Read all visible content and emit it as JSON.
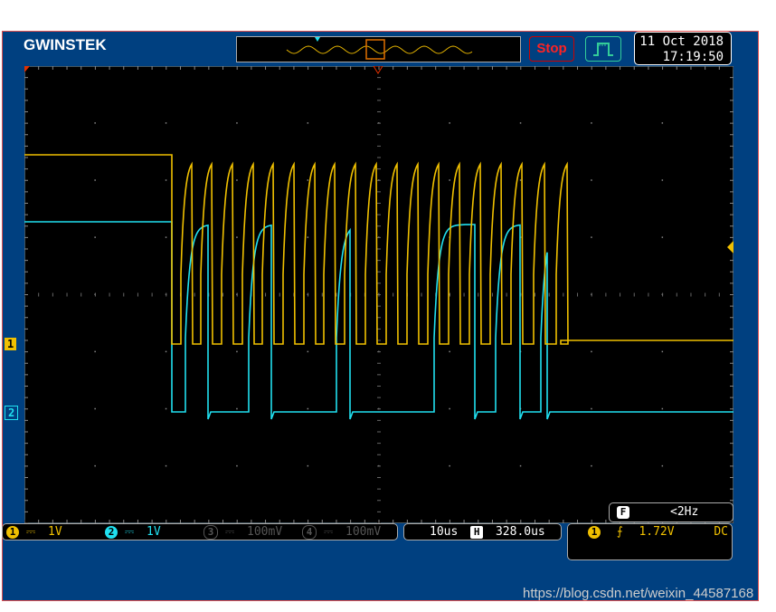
{
  "header": {
    "brand": "GWINSTEK",
    "run_state": "Stop",
    "date": "11 Oct 2018",
    "time": "17:19:50",
    "trigger_mode_icon": "pulse-icon"
  },
  "channels": [
    {
      "num": "1",
      "coupling": "DC",
      "scale": "1V",
      "color": "#f0c000",
      "active": true
    },
    {
      "num": "2",
      "coupling": "DC",
      "scale": "1V",
      "color": "#20e0f0",
      "active": true
    },
    {
      "num": "3",
      "coupling": "DC",
      "scale": "100mV",
      "color": "#555555",
      "active": false
    },
    {
      "num": "4",
      "coupling": "DC",
      "scale": "100mV",
      "color": "#555555",
      "active": false
    }
  ],
  "timebase": {
    "scale": "10us",
    "h_icon": "H",
    "position": "328.0us"
  },
  "trigger": {
    "source": "1",
    "slope": "rising",
    "level": "1.72V",
    "coupling": "DC",
    "freq_icon": "F",
    "frequency": "<2Hz"
  },
  "markers": {
    "ch1": "1",
    "ch2": "2"
  },
  "watermark": "https://blog.csdn.net/weixin_44587168"
}
